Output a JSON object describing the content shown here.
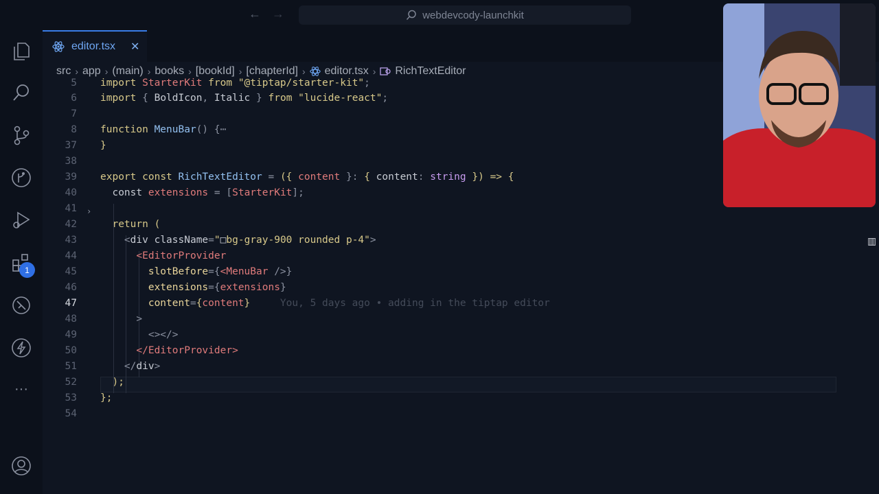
{
  "window": {
    "search_text": "webdevcody-launchkit"
  },
  "activity_bar": {
    "items": [
      "files-icon",
      "search-icon",
      "source-control-icon",
      "git-graph-icon",
      "run-debug-icon",
      "extensions-icon",
      "remote-explorer-icon",
      "lightning-icon",
      "more-icon"
    ],
    "extensions_badge": "1"
  },
  "tab": {
    "label": "editor.tsx",
    "close": "✕"
  },
  "breadcrumb": [
    "src",
    "app",
    "(main)",
    "books",
    "[bookId]",
    "[chapterId]",
    "editor.tsx",
    "RichTextEditor"
  ],
  "editor": {
    "line_numbers": [
      "5",
      "6",
      "7",
      "8",
      "37",
      "38",
      "39",
      "40",
      "41",
      "42",
      "43",
      "44",
      "45",
      "46",
      "47",
      "48",
      "49",
      "50",
      "51",
      "52",
      "53",
      "54"
    ],
    "current_line": "47",
    "blame": "You, 5 days ago • adding in the tiptap editor"
  },
  "colors": {
    "accent": "#3a7de8",
    "background": "#0f1521"
  }
}
